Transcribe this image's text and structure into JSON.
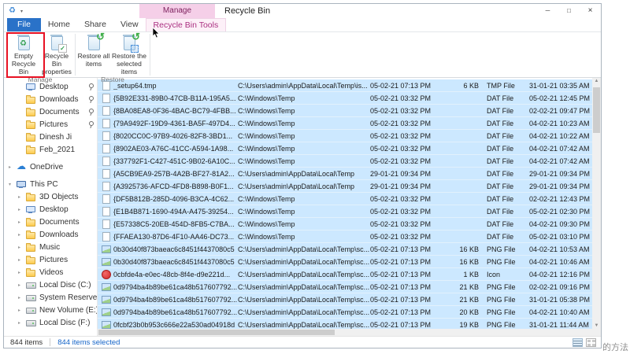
{
  "window": {
    "title": "Recycle Bin",
    "contextual_group_label": "Manage",
    "controls": {
      "minimize": "─",
      "maximize": "□",
      "close": "×"
    }
  },
  "ribbon": {
    "tabs": [
      {
        "label": "File"
      },
      {
        "label": "Home"
      },
      {
        "label": "Share"
      },
      {
        "label": "View"
      },
      {
        "label": "Recycle Bin Tools"
      }
    ],
    "groups": [
      {
        "label": "Manage",
        "buttons": [
          {
            "label": "Empty Recycle Bin"
          },
          {
            "label": "Recycle Bin properties"
          }
        ]
      },
      {
        "label": "Restore",
        "buttons": [
          {
            "label": "Restore all items"
          },
          {
            "label": "Restore the selected items"
          }
        ]
      }
    ]
  },
  "icons": {
    "chevron_collapsed": "▸",
    "chevron_expanded": "▾",
    "qat_arrow": "▾",
    "app_icon": "♻"
  },
  "colors": {
    "file_tab_blue": "#2a72c8",
    "contextual_pink": "#f5cfe8",
    "selection_blue": "#cce8ff",
    "annotation_red": "#e81123",
    "selected_text_blue": "#1464c8"
  },
  "sidebar": {
    "items": [
      {
        "label": "Desktop",
        "icon": "monitor",
        "indent": 1,
        "pinned": true
      },
      {
        "label": "Downloads",
        "icon": "folder",
        "indent": 1,
        "pinned": true
      },
      {
        "label": "Documents",
        "icon": "folder",
        "indent": 1,
        "pinned": true
      },
      {
        "label": "Pictures",
        "icon": "folder",
        "indent": 1,
        "pinned": true
      },
      {
        "label": "Dinesh Ji",
        "icon": "folder",
        "indent": 1
      },
      {
        "label": "Feb_2021",
        "icon": "folder",
        "indent": 1
      },
      {
        "label": "OneDrive",
        "icon": "cloud",
        "chevron": "closed",
        "gap": true
      },
      {
        "label": "This PC",
        "icon": "pc",
        "chevron": "open",
        "gap": true
      },
      {
        "label": "3D Objects",
        "icon": "folder",
        "indent": 1,
        "chevron": "closed"
      },
      {
        "label": "Desktop",
        "icon": "monitor",
        "indent": 1,
        "chevron": "closed"
      },
      {
        "label": "Documents",
        "icon": "folder",
        "indent": 1,
        "chevron": "closed"
      },
      {
        "label": "Downloads",
        "icon": "folder",
        "indent": 1,
        "chevron": "closed"
      },
      {
        "label": "Music",
        "icon": "folder",
        "indent": 1,
        "chevron": "closed"
      },
      {
        "label": "Pictures",
        "icon": "folder",
        "indent": 1,
        "chevron": "closed"
      },
      {
        "label": "Videos",
        "icon": "folder",
        "indent": 1,
        "chevron": "closed"
      },
      {
        "label": "Local Disc (C:)",
        "icon": "drive",
        "indent": 1,
        "chevron": "closed"
      },
      {
        "label": "System Reserved",
        "icon": "drive",
        "indent": 1,
        "chevron": "closed"
      },
      {
        "label": "New Volume (E:)",
        "icon": "drive",
        "indent": 1,
        "chevron": "closed"
      },
      {
        "label": "Local Disc (F:)",
        "icon": "drive",
        "indent": 1,
        "chevron": "closed"
      }
    ]
  },
  "file_list": {
    "rows": [
      {
        "icon": "file",
        "name": "_setup64.tmp",
        "location": "C:\\Users\\admin\\AppData\\Local\\Temp\\is...",
        "deleted": "05-02-21 07:13 PM",
        "size": "6 KB",
        "type": "TMP File",
        "modified": "31-01-21 03:35 AM"
      },
      {
        "icon": "file",
        "name": "{5B92E331-89B0-47CB-B11A-195A5...",
        "location": "C:\\Windows\\Temp",
        "deleted": "05-02-21 03:32 PM",
        "size": "",
        "type": "DAT File",
        "modified": "05-02-21 12:45 PM"
      },
      {
        "icon": "file",
        "name": "{8BA08EA8-0F36-4BAC-BC79-4FBB...",
        "location": "C:\\Windows\\Temp",
        "deleted": "05-02-21 03:32 PM",
        "size": "",
        "type": "DAT File",
        "modified": "02-02-21 09:47 PM"
      },
      {
        "icon": "file",
        "name": "{79A9492F-19D9-4361-BA5F-497D4...",
        "location": "C:\\Windows\\Temp",
        "deleted": "05-02-21 03:32 PM",
        "size": "",
        "type": "DAT File",
        "modified": "04-02-21 10:23 AM"
      },
      {
        "icon": "file",
        "name": "{8020CC0C-97B9-4026-82F8-3BD1...",
        "location": "C:\\Windows\\Temp",
        "deleted": "05-02-21 03:32 PM",
        "size": "",
        "type": "DAT File",
        "modified": "04-02-21 10:22 AM"
      },
      {
        "icon": "file",
        "name": "{8902AE03-A76C-41CC-A594-1A98...",
        "location": "C:\\Windows\\Temp",
        "deleted": "05-02-21 03:32 PM",
        "size": "",
        "type": "DAT File",
        "modified": "04-02-21 07:42 AM"
      },
      {
        "icon": "file",
        "name": "{337792F1-C427-451C-9B02-6A10C...",
        "location": "C:\\Windows\\Temp",
        "deleted": "05-02-21 03:32 PM",
        "size": "",
        "type": "DAT File",
        "modified": "04-02-21 07:42 AM"
      },
      {
        "icon": "file",
        "name": "{A5CB9EA9-257B-4A2B-BF27-81A2...",
        "location": "C:\\Users\\admin\\AppData\\Local\\Temp",
        "deleted": "29-01-21 09:34 PM",
        "size": "",
        "type": "DAT File",
        "modified": "29-01-21 09:34 PM"
      },
      {
        "icon": "file",
        "name": "{A3925736-AFCD-4FD8-B898-B0F1...",
        "location": "C:\\Users\\admin\\AppData\\Local\\Temp",
        "deleted": "29-01-21 09:34 PM",
        "size": "",
        "type": "DAT File",
        "modified": "29-01-21 09:34 PM"
      },
      {
        "icon": "file",
        "name": "{DF5B812B-285D-4096-B3CA-4C62...",
        "location": "C:\\Windows\\Temp",
        "deleted": "05-02-21 03:32 PM",
        "size": "",
        "type": "DAT File",
        "modified": "02-02-21 12:43 PM"
      },
      {
        "icon": "file",
        "name": "{E1B4B871-1690-494A-A475-39254...",
        "location": "C:\\Windows\\Temp",
        "deleted": "05-02-21 03:32 PM",
        "size": "",
        "type": "DAT File",
        "modified": "05-02-21 02:30 PM"
      },
      {
        "icon": "file",
        "name": "{E57338C5-20EB-454D-8FB5-C7BA...",
        "location": "C:\\Windows\\Temp",
        "deleted": "05-02-21 03:32 PM",
        "size": "",
        "type": "DAT File",
        "modified": "04-02-21 09:30 PM"
      },
      {
        "icon": "file",
        "name": "{FFAEA130-87D6-4F10-AA46-DC73...",
        "location": "C:\\Windows\\Temp",
        "deleted": "05-02-21 03:32 PM",
        "size": "",
        "type": "DAT File",
        "modified": "05-02-21 03:10 PM"
      },
      {
        "icon": "image",
        "name": "0b30d40f873baeac6c8451f4437080c5",
        "location": "C:\\Users\\admin\\AppData\\Local\\Temp\\sc...",
        "deleted": "05-02-21 07:13 PM",
        "size": "16 KB",
        "type": "PNG File",
        "modified": "04-02-21 10:53 AM"
      },
      {
        "icon": "image",
        "name": "0b30d40f873baeac6c8451f4437080c5",
        "location": "C:\\Users\\admin\\AppData\\Local\\Temp\\sc...",
        "deleted": "05-02-21 07:13 PM",
        "size": "16 KB",
        "type": "PNG File",
        "modified": "04-02-21 10:46 AM"
      },
      {
        "icon": "red-app",
        "name": "0cbfde4a-e0ec-48cb-8f4e-d9e221d...",
        "location": "C:\\Users\\admin\\AppData\\Local\\Temp\\sc...",
        "deleted": "05-02-21 07:13 PM",
        "size": "1 KB",
        "type": "Icon",
        "modified": "04-02-21 12:16 PM"
      },
      {
        "icon": "image",
        "name": "0d9794ba4b89be61ca48b517607792...",
        "location": "C:\\Users\\admin\\AppData\\Local\\Temp\\sc...",
        "deleted": "05-02-21 07:13 PM",
        "size": "21 KB",
        "type": "PNG File",
        "modified": "02-02-21 09:16 PM"
      },
      {
        "icon": "image",
        "name": "0d9794ba4b89be61ca48b517607792...",
        "location": "C:\\Users\\admin\\AppData\\Local\\Temp\\sc...",
        "deleted": "05-02-21 07:13 PM",
        "size": "21 KB",
        "type": "PNG File",
        "modified": "31-01-21 05:38 PM"
      },
      {
        "icon": "image",
        "name": "0d9794ba4b89be61ca48b517607792...",
        "location": "C:\\Users\\admin\\AppData\\Local\\Temp\\sc...",
        "deleted": "05-02-21 07:13 PM",
        "size": "20 KB",
        "type": "PNG File",
        "modified": "04-02-21 10:40 AM"
      },
      {
        "icon": "image",
        "name": "0fcbf23b0b953c666e22a530ad04918d",
        "location": "C:\\Users\\admin\\AppData\\Local\\Temp\\sc...",
        "deleted": "05-02-21 07:13 PM",
        "size": "19 KB",
        "type": "PNG File",
        "modified": "31-01-21 11:44 AM"
      }
    ]
  },
  "status_bar": {
    "items": "844 items",
    "selected": "844 items selected"
  },
  "watermark": "的方法"
}
